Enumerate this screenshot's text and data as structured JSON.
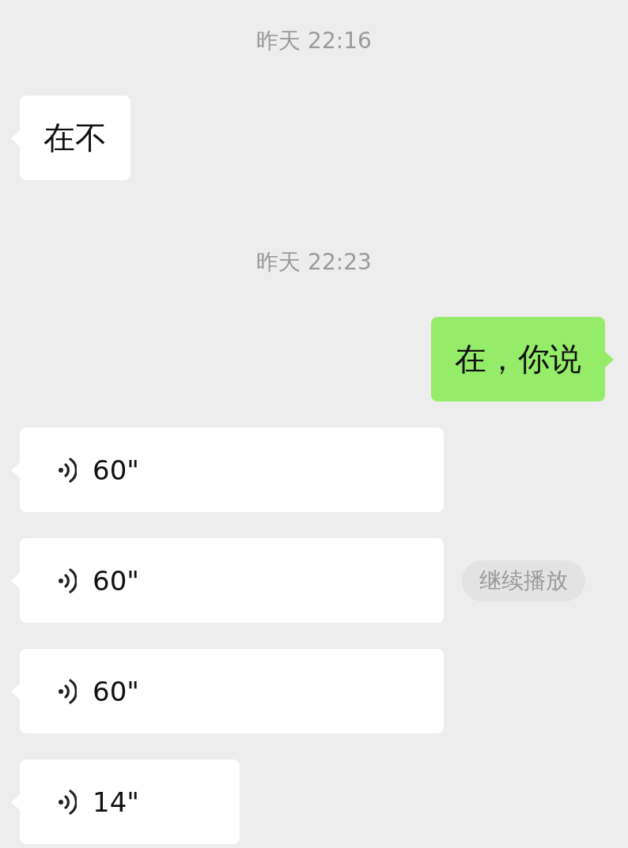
{
  "messages": [
    {
      "kind": "timestamp",
      "text": "昨天 22:16"
    },
    {
      "kind": "text",
      "outgoing": false,
      "text": "在不"
    },
    {
      "kind": "timestamp",
      "text": "昨天 22:23"
    },
    {
      "kind": "text",
      "outgoing": true,
      "text": "在，你说"
    },
    {
      "kind": "voice",
      "outgoing": false,
      "duration": "60\""
    },
    {
      "kind": "voice",
      "outgoing": false,
      "duration": "60\"",
      "action": "继续播放"
    },
    {
      "kind": "voice",
      "outgoing": false,
      "duration": "60\""
    },
    {
      "kind": "voice",
      "outgoing": false,
      "duration": "14\""
    }
  ]
}
